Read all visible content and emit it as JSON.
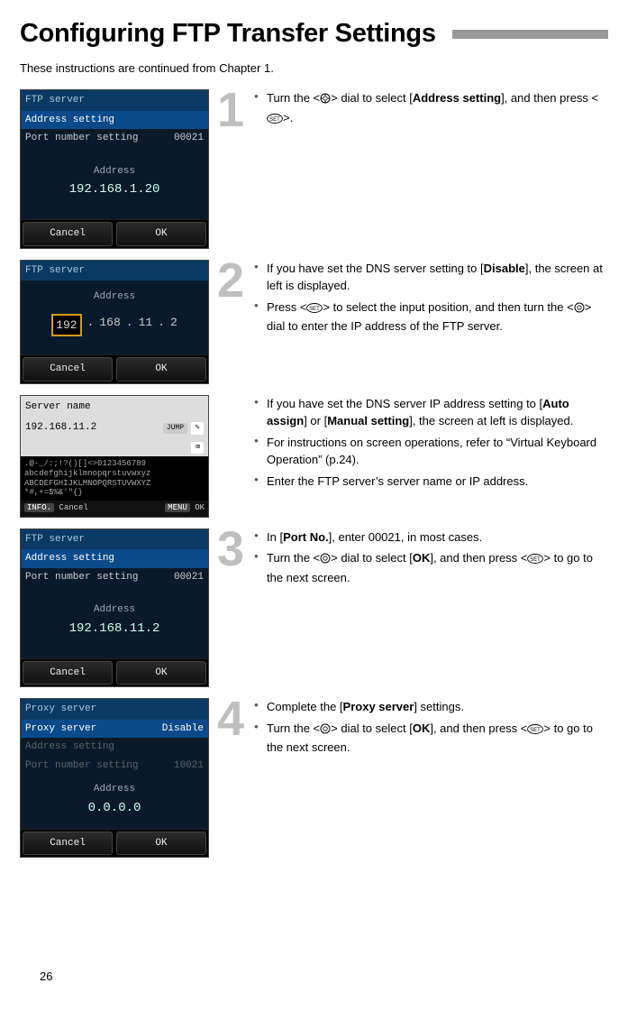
{
  "page_number": "26",
  "title": "Configuring FTP Transfer Settings",
  "intro": "These instructions are continued from Chapter 1.",
  "steps": {
    "s1": {
      "num": "1",
      "bullet1_a": "Turn the <",
      "bullet1_b": "> dial to select [",
      "bullet1_bold": "Address setting",
      "bullet1_c": "], and then press <",
      "bullet1_d": ">.",
      "thumb": {
        "head": "FTP server",
        "row1": "Address setting",
        "row2_l": "Port number setting",
        "row2_r": "00021",
        "mid_lbl": "Address",
        "mid_val": "192.168.1.20",
        "cancel": "Cancel",
        "ok": "OK"
      }
    },
    "s2a": {
      "num": "2",
      "b1_a": "If you have set the DNS server setting to [",
      "b1_bold": "Disable",
      "b1_b": "], the screen at left is displayed.",
      "b2_a": "Press <",
      "b2_b": "> to select the input position, and then turn the <",
      "b2_c": "> dial to enter the IP address of the FTP server.",
      "thumb": {
        "head": "FTP server",
        "mid_lbl": "Address",
        "ip1": "192",
        "ip2": "168",
        "ip3": "11",
        "ip4": "2",
        "cancel": "Cancel",
        "ok": "OK"
      }
    },
    "s2b": {
      "b1_a": "If you have set the DNS server IP address setting to [",
      "b1_bold1": "Auto assign",
      "b1_mid": "] or [",
      "b1_bold2": "Manual setting",
      "b1_b": "], the screen at left is displayed.",
      "b2": "For instructions on screen operations, refer to “Virtual Keyboard Operation” (p.24).",
      "b3": "Enter the FTP server’s server name or IP address.",
      "thumb": {
        "head": "Server name",
        "ip": "192.168.11.2",
        "jump": "JUMP",
        "kbd1": ".@-_/:;!?()[]<>0123456789",
        "kbd2": "abcdefghijklmnopqrstuvwxyz",
        "kbd3": "ABCDEFGHIJKLMNOPQRSTUVWXYZ",
        "kbd4": "*#,+=$%&'\"{}",
        "info": "INFO.",
        "cancel": "Cancel",
        "menu": "MENU",
        "ok": "OK"
      }
    },
    "s3": {
      "num": "3",
      "b1_a": "In [",
      "b1_bold": "Port No.",
      "b1_b": "], enter 00021, in most cases.",
      "b2_a": "Turn the <",
      "b2_b": "> dial to select [",
      "b2_bold": "OK",
      "b2_c": "], and then press <",
      "b2_d": "> to go to the next screen.",
      "thumb": {
        "head": "FTP server",
        "row1": "Address setting",
        "row2_l": "Port number setting",
        "row2_r": "00021",
        "mid_lbl": "Address",
        "mid_val": "192.168.11.2",
        "cancel": "Cancel",
        "ok": "OK"
      }
    },
    "s4": {
      "num": "4",
      "b1_a": "Complete the [",
      "b1_bold": "Proxy server",
      "b1_b": "] settings.",
      "b2_a": "Turn the <",
      "b2_b": "> dial to select [",
      "b2_bold": "OK",
      "b2_c": "], and then press <",
      "b2_d": "> to go to the next screen.",
      "thumb": {
        "head": "Proxy server",
        "row1_l": "Proxy server",
        "row1_r": "Disable",
        "row2": "Address setting",
        "row3_l": "Port number setting",
        "row3_r": "10021",
        "mid_lbl": "Address",
        "mid_val": "0.0.0.0",
        "cancel": "Cancel",
        "ok": "OK"
      }
    }
  }
}
